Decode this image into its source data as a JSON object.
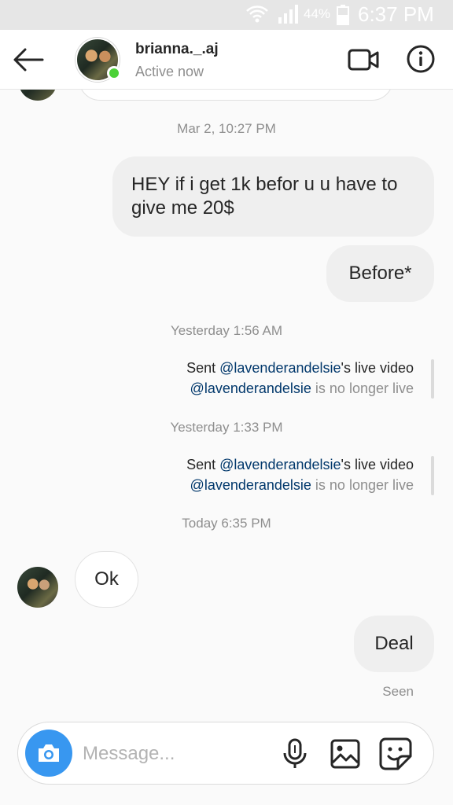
{
  "status_bar": {
    "battery_pct": "44%",
    "clock": "6:37 PM"
  },
  "header": {
    "username": "brianna._.aj",
    "active_status": "Active now"
  },
  "messages": {
    "timestamp_1": "Mar 2, 10:27 PM",
    "out_1_line1": "HEY if i get 1k befor u u have to",
    "out_1_line2": "give me 20$",
    "out_2": "Before*",
    "timestamp_2": "Yesterday 1:56 AM",
    "share_1": {
      "sent_prefix": "Sent ",
      "mention": "@lavenderandelsie",
      "sent_suffix": "'s live video",
      "status_mention": "@lavenderandelsie",
      "status_text": " is no longer live"
    },
    "timestamp_3": "Yesterday 1:33 PM",
    "share_2": {
      "sent_prefix": "Sent ",
      "mention": "@lavenderandelsie",
      "sent_suffix": "'s live video",
      "status_mention": "@lavenderandelsie",
      "status_text": " is no longer live"
    },
    "timestamp_4": "Today 6:35 PM",
    "in_1": "Ok",
    "out_3": "Deal",
    "seen": "Seen"
  },
  "composer": {
    "placeholder": "Message..."
  },
  "icons": {
    "back": "arrow-left-icon",
    "video": "video-camera-icon",
    "info": "info-icon",
    "camera": "camera-icon",
    "mic": "microphone-icon",
    "gallery": "image-icon",
    "sticker": "sticker-icon"
  },
  "colors": {
    "accent_blue": "#3897f0",
    "online_green": "#4cd137",
    "mention_blue": "#00376b"
  }
}
